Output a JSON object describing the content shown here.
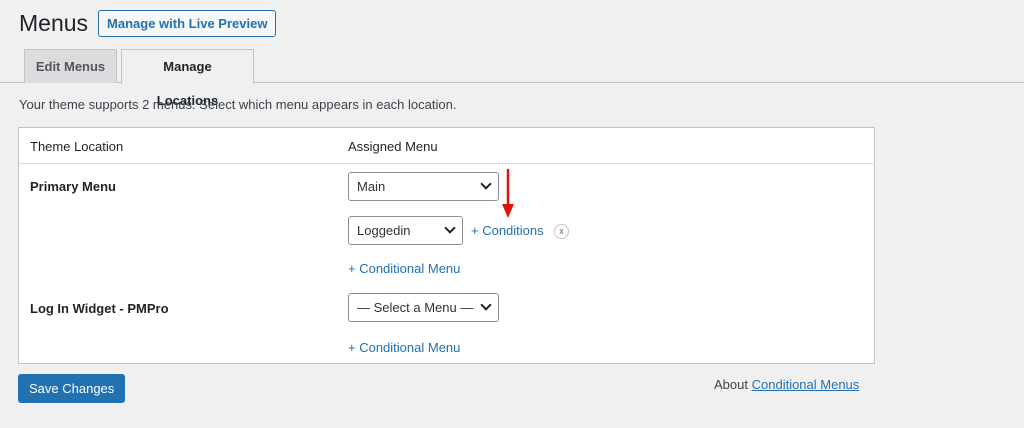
{
  "header": {
    "title": "Menus",
    "live_preview_label": "Manage with Live Preview"
  },
  "tabs": [
    {
      "label": "Edit Menus",
      "active": false
    },
    {
      "label": "Manage Locations",
      "active": true
    }
  ],
  "intro_text": "Your theme supports 2 menus. Select which menu appears in each location.",
  "table": {
    "col_location": "Theme Location",
    "col_menu": "Assigned Menu"
  },
  "locations": [
    {
      "label": "Primary Menu",
      "selected_menu": "Main",
      "conditional": {
        "selected_menu": "Loggedin",
        "conditions_link": "+ Conditions",
        "remove_label": "x"
      },
      "add_conditional_link": "+ Conditional Menu"
    },
    {
      "label": "Log In Widget - PMPro",
      "selected_menu": "— Select a Menu —",
      "add_conditional_link": "+ Conditional Menu"
    }
  ],
  "footer": {
    "save_label": "Save Changes",
    "about_prefix": "About",
    "about_link": "Conditional Menus"
  },
  "colors": {
    "accent": "#2271b1",
    "annotation_arrow": "#e0140f",
    "background": "#f0f0f1"
  }
}
